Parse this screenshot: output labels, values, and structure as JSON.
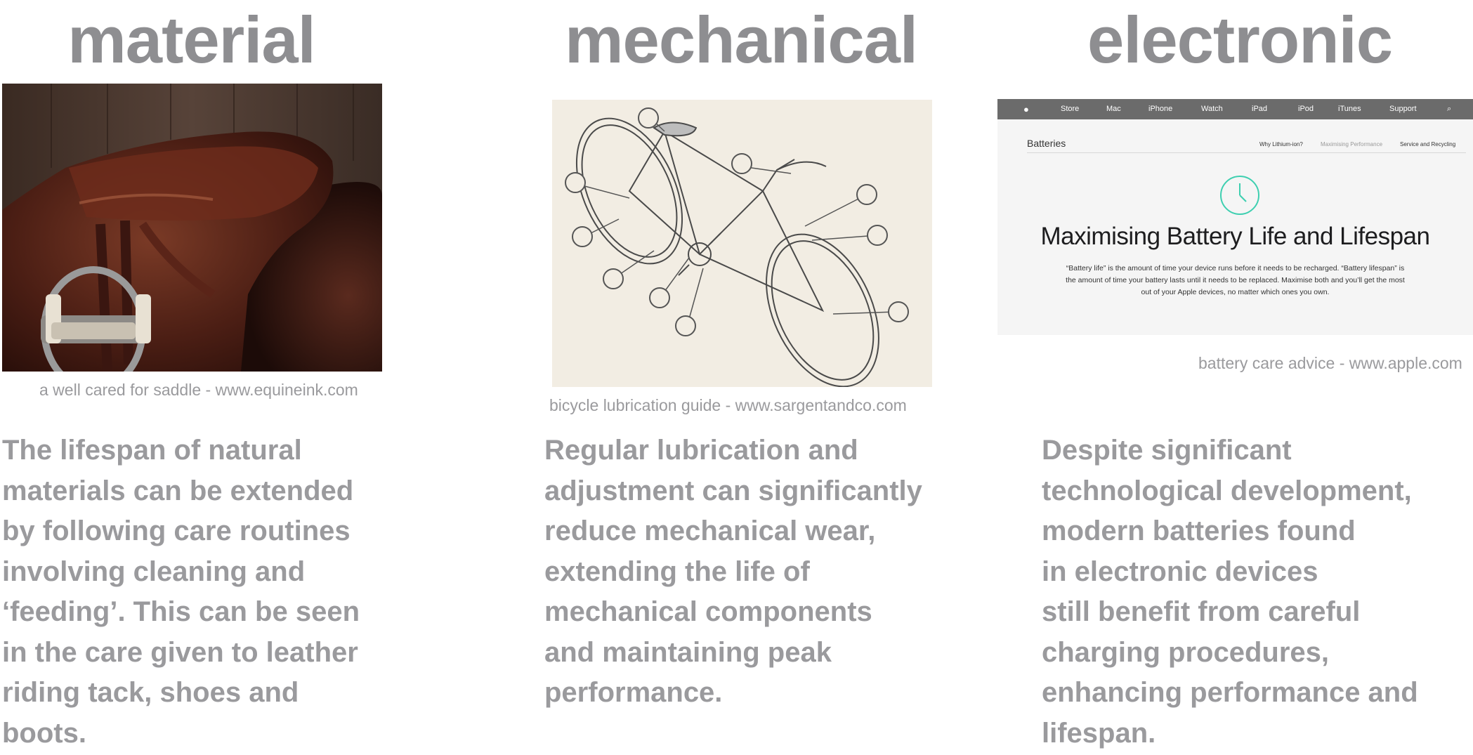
{
  "columns": [
    {
      "heading": "material",
      "caption": "a well cared for saddle - www.equineink.com",
      "body": "The lifespan of natural\nmaterials can be extended\nby following care routines\ninvolving cleaning and\n‘feeding’. This can be seen\nin the care given to leather\nriding tack, shoes and\nboots."
    },
    {
      "heading": "mechanical",
      "caption": "bicycle lubrication guide - www.sargentandco.com",
      "body": "Regular lubrication and\nadjustment can significantly\nreduce mechanical wear,\nextending the life of\nmechanical components\nand maintaining peak\nperformance."
    },
    {
      "heading": "electronic",
      "caption": "battery care advice - www.apple.com",
      "body": "Despite significant\ntechnological development,\nmodern batteries found\nin electronic devices\nstill benefit from careful\ncharging procedures,\nenhancing performance and\nlifespan."
    }
  ],
  "apple_page": {
    "nav": [
      "Store",
      "Mac",
      "iPhone",
      "Watch",
      "iPad",
      "iPod",
      "iTunes",
      "Support"
    ],
    "section_title": "Batteries",
    "sub_links": [
      "Why Lithium-ion?",
      "Maximising Performance",
      "Service and Recycling"
    ],
    "headline": "Maximising Battery Life and Lifespan",
    "paragraph": "“Battery life” is the amount of time your device runs before it needs to be recharged. “Battery lifespan” is the amount of time your battery lasts until it needs to be replaced. Maximise both and you’ll get the most out of your Apple devices, no matter which ones you own."
  },
  "colors": {
    "text_gray": "#939396",
    "clock_teal": "#3ecfb0",
    "nav_bg": "#6b6b6b"
  }
}
